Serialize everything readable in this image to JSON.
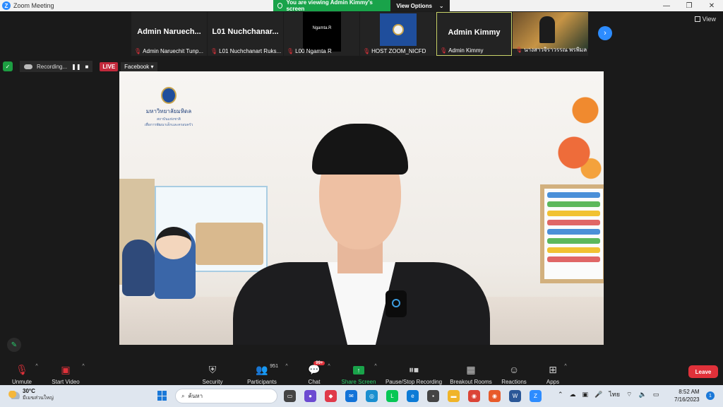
{
  "window": {
    "title": "Zoom Meeting",
    "minimize": "—",
    "maximize": "❐",
    "close": "✕"
  },
  "share_banner": {
    "viewing": "You are viewing Admin Kimmy's screen",
    "view_options": "View Options",
    "caret": "⌄"
  },
  "view_button": {
    "label": "View"
  },
  "participants": [
    {
      "big_name": "Admin  Naruech...",
      "label": "Admin Naruechit Tunp..."
    },
    {
      "big_name": "L01  Nuchchanar...",
      "label": "L01 Nuchchanart Ruks..."
    },
    {
      "video_text": "Ngamta.R",
      "label": "L00 Ngamta R"
    },
    {
      "label": "HOST ZOOM_NICFD"
    },
    {
      "big_name": "Admin Kimmy",
      "label": "Admin Kimmy"
    },
    {
      "label": "นางสาวจิราวรรณ พรพิมล"
    }
  ],
  "recording": {
    "status": "Recording...",
    "pause": "❚❚",
    "stop": "■",
    "live": "LIVE",
    "destination": "Facebook",
    "caret": "▾"
  },
  "shared_screen": {
    "logo_line1": "มหาวิทยาลัยมหิดล",
    "logo_line2": "สถาบันแห่งชาติ",
    "logo_line3": "เพื่อการพัฒนาเด็กและครอบครัว"
  },
  "toolbar": {
    "unmute": "Unmute",
    "start_video": "Start Video",
    "security": "Security",
    "participants": "Participants",
    "participant_count": "951",
    "chat": "Chat",
    "chat_badge": "99+",
    "share_screen": "Share Screen",
    "pause_stop_recording": "Pause/Stop Recording",
    "breakout_rooms": "Breakout Rooms",
    "reactions": "Reactions",
    "apps": "Apps",
    "leave": "Leave",
    "caret": "^"
  },
  "taskbar": {
    "temperature": "30°C",
    "weather_desc": "มีเมฆส่วนใหญ่",
    "search_placeholder": "ค้นหา",
    "language": "ไทย",
    "time": "8:52 AM",
    "date": "7/16/2023",
    "notification_count": "1"
  },
  "colors": {
    "zoom_blue": "#2d8cff",
    "share_green": "#19a34a",
    "leave_red": "#e0313a",
    "live_red": "#c2293b"
  }
}
